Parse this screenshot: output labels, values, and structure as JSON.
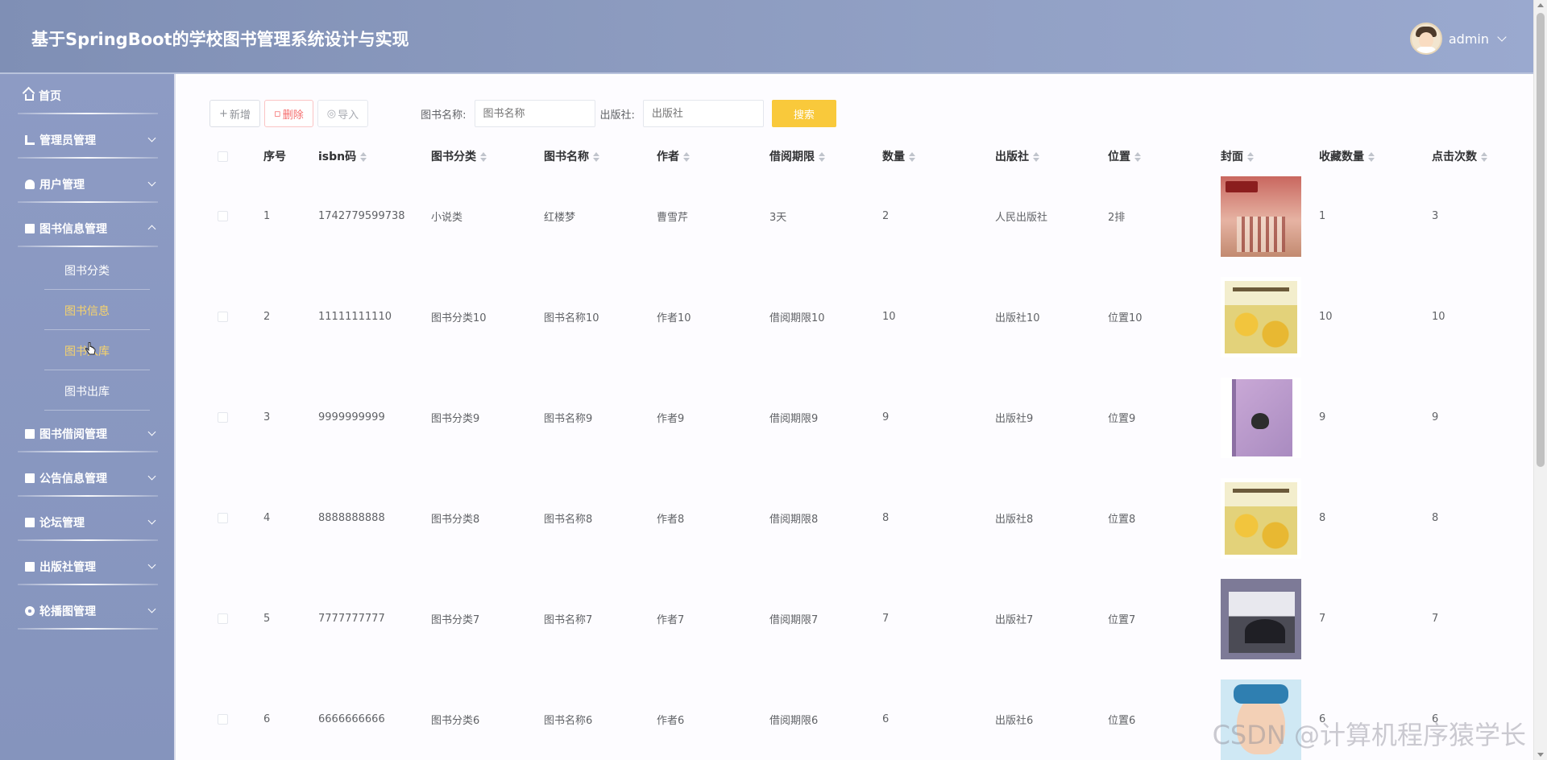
{
  "app": {
    "title": "基于SpringBoot的学校图书管理系统设计与实现",
    "user": {
      "name": "admin"
    }
  },
  "sidebar": {
    "items": [
      {
        "label": "首页",
        "icon": "home-icon",
        "expandable": false
      },
      {
        "label": "管理员管理",
        "icon": "tree-icon",
        "expandable": true
      },
      {
        "label": "用户管理",
        "icon": "user-icon",
        "expandable": true
      },
      {
        "label": "图书信息管理",
        "icon": "book-icon",
        "expandable": true,
        "expanded": true,
        "children": [
          {
            "label": "图书分类",
            "active": false
          },
          {
            "label": "图书信息",
            "active": true
          },
          {
            "label": "图书入库",
            "active": true
          },
          {
            "label": "图书出库",
            "active": false
          }
        ]
      },
      {
        "label": "图书借阅管理",
        "icon": "book-icon",
        "expandable": true
      },
      {
        "label": "公告信息管理",
        "icon": "notice-icon",
        "expandable": true
      },
      {
        "label": "论坛管理",
        "icon": "forum-icon",
        "expandable": true
      },
      {
        "label": "出版社管理",
        "icon": "publisher-icon",
        "expandable": true
      },
      {
        "label": "轮播图管理",
        "icon": "carousel-icon",
        "expandable": true
      }
    ]
  },
  "toolbar": {
    "add_label": "新增",
    "delete_label": "删除",
    "import_label": "导入",
    "book_name_label": "图书名称:",
    "book_name_placeholder": "图书名称",
    "publisher_label": "出版社:",
    "publisher_placeholder": "出版社",
    "search_label": "搜索"
  },
  "table": {
    "columns": {
      "idx": "序号",
      "isbn": "isbn码",
      "category": "图书分类",
      "name": "图书名称",
      "author": "作者",
      "period": "借阅期限",
      "qty": "数量",
      "publisher": "出版社",
      "location": "位置",
      "cover": "封面",
      "favorites": "收藏数量",
      "clicks": "点击次数"
    },
    "rows": [
      {
        "idx": "1",
        "isbn": "1742779599738",
        "category": "小说类",
        "name": "红楼梦",
        "author": "曹雪芹",
        "period": "3天",
        "qty": "2",
        "publisher": "人民出版社",
        "location": "2排",
        "cover": "red",
        "favorites": "1",
        "clicks": "3"
      },
      {
        "idx": "2",
        "isbn": "11111111110",
        "category": "图书分类10",
        "name": "图书名称10",
        "author": "作者10",
        "period": "借阅期限10",
        "qty": "10",
        "publisher": "出版社10",
        "location": "位置10",
        "cover": "yellow",
        "favorites": "10",
        "clicks": "10"
      },
      {
        "idx": "3",
        "isbn": "9999999999",
        "category": "图书分类9",
        "name": "图书名称9",
        "author": "作者9",
        "period": "借阅期限9",
        "qty": "9",
        "publisher": "出版社9",
        "location": "位置9",
        "cover": "purple",
        "favorites": "9",
        "clicks": "9"
      },
      {
        "idx": "4",
        "isbn": "8888888888",
        "category": "图书分类8",
        "name": "图书名称8",
        "author": "作者8",
        "period": "借阅期限8",
        "qty": "8",
        "publisher": "出版社8",
        "location": "位置8",
        "cover": "yellow",
        "favorites": "8",
        "clicks": "8"
      },
      {
        "idx": "5",
        "isbn": "7777777777",
        "category": "图书分类7",
        "name": "图书名称7",
        "author": "作者7",
        "period": "借阅期限7",
        "qty": "7",
        "publisher": "出版社7",
        "location": "位置7",
        "cover": "gray",
        "favorites": "7",
        "clicks": "7"
      },
      {
        "idx": "6",
        "isbn": "6666666666",
        "category": "图书分类6",
        "name": "图书名称6",
        "author": "作者6",
        "period": "借阅期限6",
        "qty": "6",
        "publisher": "出版社6",
        "location": "位置6",
        "cover": "blue",
        "favorites": "6",
        "clicks": "6"
      }
    ]
  },
  "watermark": "CSDN @计算机程序猿学长"
}
